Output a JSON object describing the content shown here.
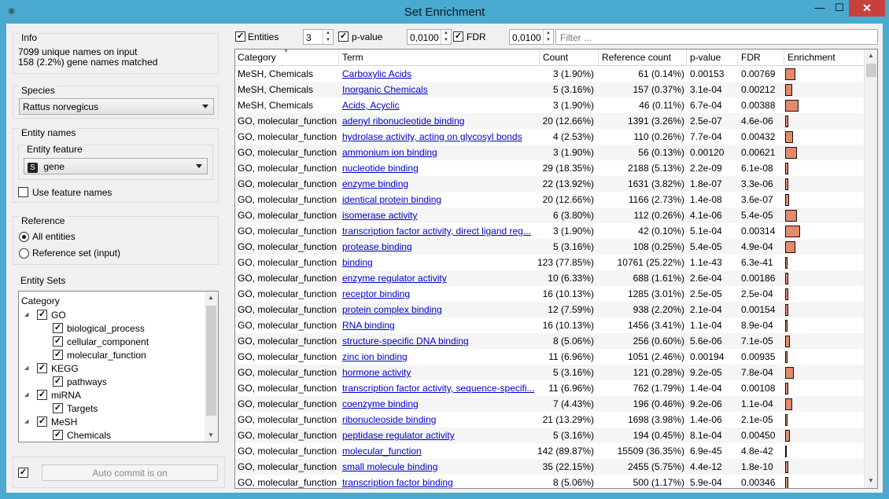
{
  "window": {
    "title": "Set Enrichment",
    "app_icon": "❃",
    "min": "—",
    "max": "☐",
    "close": "✕"
  },
  "info": {
    "title": "Info",
    "line1": "7099 unique names on input",
    "line2": "158 (2.2%) gene names matched"
  },
  "species": {
    "title": "Species",
    "value": "Rattus norvegicus"
  },
  "entity_names": {
    "title": "Entity names",
    "feature_title": "Entity feature",
    "feature_badge": "S",
    "feature_value": "gene",
    "use_feature_label": "Use feature names"
  },
  "reference": {
    "title": "Reference",
    "option1": "All entities",
    "option2": "Reference set (input)"
  },
  "entity_sets": {
    "title": "Entity Sets",
    "header": "Category",
    "tree": [
      {
        "label": "GO",
        "level": 0,
        "expander": "◢"
      },
      {
        "label": "biological_process",
        "level": 1
      },
      {
        "label": "cellular_component",
        "level": 1
      },
      {
        "label": "molecular_function",
        "level": 1
      },
      {
        "label": "KEGG",
        "level": 0,
        "expander": "◢"
      },
      {
        "label": "pathways",
        "level": 1
      },
      {
        "label": "miRNA",
        "level": 0,
        "expander": "◢"
      },
      {
        "label": "Targets",
        "level": 1
      },
      {
        "label": "MeSH",
        "level": 0,
        "expander": "◢"
      },
      {
        "label": "Chemicals",
        "level": 1
      }
    ]
  },
  "commit": {
    "label": "Auto commit is on"
  },
  "filters": {
    "entities_label": "Entities",
    "entities_value": "3",
    "pvalue_label": "p-value",
    "pvalue_value": "0,0100",
    "fdr_label": "FDR",
    "fdr_value": "0,0100",
    "filter_placeholder": "Filter ..."
  },
  "table": {
    "headers": [
      "Category",
      "Term",
      "Count",
      "Reference count",
      "p-value",
      "FDR",
      "Enrichment"
    ],
    "rows": [
      {
        "category": "MeSH, Chemicals",
        "term": "Carboxylic Acids",
        "count": "3  (1.90%)",
        "ref": "61  (0.14%)",
        "pvalue": "0.00153",
        "fdr": "0.00769",
        "enrichment": 0.13
      },
      {
        "category": "MeSH, Chemicals",
        "term": "Inorganic Chemicals",
        "count": "5  (3.16%)",
        "ref": "157  (0.37%)",
        "pvalue": "3.1e-04",
        "fdr": "0.00212",
        "enrichment": 0.09
      },
      {
        "category": "MeSH, Chemicals",
        "term": "Acids, Acyclic",
        "count": "3  (1.90%)",
        "ref": "46  (0.11%)",
        "pvalue": "6.7e-04",
        "fdr": "0.00388",
        "enrichment": 0.17
      },
      {
        "category": "GO, molecular_function",
        "term": "adenyl ribonucleotide binding",
        "count": "20  (12.66%)",
        "ref": "1391  (3.26%)",
        "pvalue": "2.5e-07",
        "fdr": "4.6e-06",
        "enrichment": 0.04
      },
      {
        "category": "GO, molecular_function",
        "term": "hydrolase activity, acting on glycosyl bonds",
        "count": "4  (2.53%)",
        "ref": "110  (0.26%)",
        "pvalue": "7.7e-04",
        "fdr": "0.00432",
        "enrichment": 0.1
      },
      {
        "category": "GO, molecular_function",
        "term": "ammonium ion binding",
        "count": "3  (1.90%)",
        "ref": "56  (0.13%)",
        "pvalue": "0.00120",
        "fdr": "0.00621",
        "enrichment": 0.15
      },
      {
        "category": "GO, molecular_function",
        "term": "nucleotide binding",
        "count": "29  (18.35%)",
        "ref": "2188  (5.13%)",
        "pvalue": "2.2e-09",
        "fdr": "6.1e-08",
        "enrichment": 0.04
      },
      {
        "category": "GO, molecular_function",
        "term": "enzyme binding",
        "count": "22  (13.92%)",
        "ref": "1631  (3.82%)",
        "pvalue": "1.8e-07",
        "fdr": "3.3e-06",
        "enrichment": 0.04
      },
      {
        "category": "GO, molecular_function",
        "term": "identical protein binding",
        "count": "20  (12.66%)",
        "ref": "1166  (2.73%)",
        "pvalue": "1.4e-08",
        "fdr": "3.6e-07",
        "enrichment": 0.05
      },
      {
        "category": "GO, molecular_function",
        "term": "isomerase activity",
        "count": "6  (3.80%)",
        "ref": "112  (0.26%)",
        "pvalue": "4.1e-06",
        "fdr": "5.4e-05",
        "enrichment": 0.15
      },
      {
        "category": "GO, molecular_function",
        "term": "transcription factor activity, direct ligand reg...",
        "count": "3  (1.90%)",
        "ref": "42  (0.10%)",
        "pvalue": "5.1e-04",
        "fdr": "0.00314",
        "enrichment": 0.19
      },
      {
        "category": "GO, molecular_function",
        "term": "protease binding",
        "count": "5  (3.16%)",
        "ref": "108  (0.25%)",
        "pvalue": "5.4e-05",
        "fdr": "4.9e-04",
        "enrichment": 0.13
      },
      {
        "category": "GO, molecular_function",
        "term": "binding",
        "count": "123  (77.85%)",
        "ref": "10761  (25.22%)",
        "pvalue": "1.1e-43",
        "fdr": "6.3e-41",
        "enrichment": 0.03
      },
      {
        "category": "GO, molecular_function",
        "term": "enzyme regulator activity",
        "count": "10  (6.33%)",
        "ref": "688  (1.61%)",
        "pvalue": "2.6e-04",
        "fdr": "0.00186",
        "enrichment": 0.04
      },
      {
        "category": "GO, molecular_function",
        "term": "receptor binding",
        "count": "16  (10.13%)",
        "ref": "1285  (3.01%)",
        "pvalue": "2.5e-05",
        "fdr": "2.5e-04",
        "enrichment": 0.04
      },
      {
        "category": "GO, molecular_function",
        "term": "protein complex binding",
        "count": "12  (7.59%)",
        "ref": "938  (2.20%)",
        "pvalue": "2.1e-04",
        "fdr": "0.00154",
        "enrichment": 0.04
      },
      {
        "category": "GO, molecular_function",
        "term": "RNA binding",
        "count": "16  (10.13%)",
        "ref": "1456  (3.41%)",
        "pvalue": "1.1e-04",
        "fdr": "8.9e-04",
        "enrichment": 0.03
      },
      {
        "category": "GO, molecular_function",
        "term": "structure-specific DNA binding",
        "count": "8  (5.06%)",
        "ref": "256  (0.60%)",
        "pvalue": "5.6e-06",
        "fdr": "7.1e-05",
        "enrichment": 0.06
      },
      {
        "category": "GO, molecular_function",
        "term": "zinc ion binding",
        "count": "11  (6.96%)",
        "ref": "1051  (2.46%)",
        "pvalue": "0.00194",
        "fdr": "0.00935",
        "enrichment": 0.03
      },
      {
        "category": "GO, molecular_function",
        "term": "hormone activity",
        "count": "5  (3.16%)",
        "ref": "121  (0.28%)",
        "pvalue": "9.2e-05",
        "fdr": "7.8e-04",
        "enrichment": 0.11
      },
      {
        "category": "GO, molecular_function",
        "term": "transcription factor activity, sequence-specifi...",
        "count": "11  (6.96%)",
        "ref": "762  (1.79%)",
        "pvalue": "1.4e-04",
        "fdr": "0.00108",
        "enrichment": 0.04
      },
      {
        "category": "GO, molecular_function",
        "term": "coenzyme binding",
        "count": "7  (4.43%)",
        "ref": "196  (0.46%)",
        "pvalue": "9.2e-06",
        "fdr": "1.1e-04",
        "enrichment": 0.09
      },
      {
        "category": "GO, molecular_function",
        "term": "ribonucleoside binding",
        "count": "21  (13.29%)",
        "ref": "1698  (3.98%)",
        "pvalue": "1.4e-06",
        "fdr": "2.1e-05",
        "enrichment": 0.03
      },
      {
        "category": "GO, molecular_function",
        "term": "peptidase regulator activity",
        "count": "5  (3.16%)",
        "ref": "194  (0.45%)",
        "pvalue": "8.1e-04",
        "fdr": "0.00450",
        "enrichment": 0.06
      },
      {
        "category": "GO, molecular_function",
        "term": "molecular_function",
        "count": "142  (89.87%)",
        "ref": "15509  (36.35%)",
        "pvalue": "6.9e-45",
        "fdr": "4.8e-42",
        "enrichment": 0.02
      },
      {
        "category": "GO, molecular_function",
        "term": "small molecule binding",
        "count": "35  (22.15%)",
        "ref": "2455  (5.75%)",
        "pvalue": "4.4e-12",
        "fdr": "1.8e-10",
        "enrichment": 0.04
      },
      {
        "category": "GO, molecular_function",
        "term": "transcription factor binding",
        "count": "8  (5.06%)",
        "ref": "500  (1.17%)",
        "pvalue": "5.9e-04",
        "fdr": "0.00346",
        "enrichment": 0.04
      }
    ]
  },
  "colors": {
    "window_frame": "#4aa9cf",
    "close": "#c7413c",
    "link": "#0000cc",
    "enrichment_bar": "#e5896b"
  }
}
